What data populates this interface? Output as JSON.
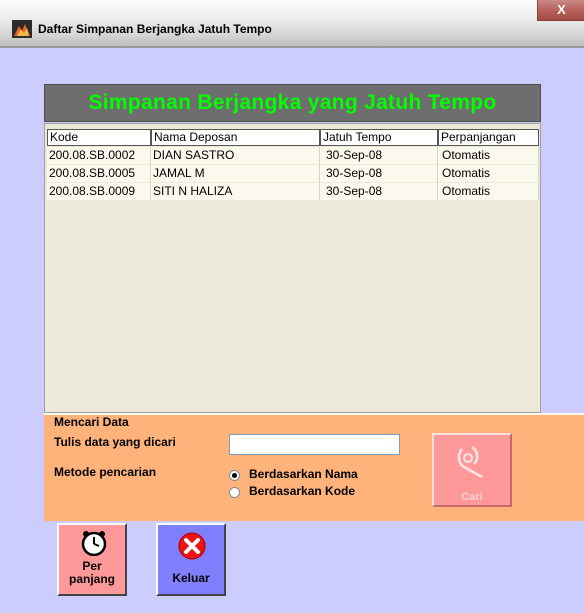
{
  "window": {
    "title": "Daftar Simpanan Berjangka Jatuh Tempo",
    "close_label": "X",
    "background_color": "#CCCCFF"
  },
  "heading": {
    "text": "Simpanan Berjangka yang Jatuh Tempo",
    "text_color": "#00FF00",
    "bar_color": "#6E6E6E"
  },
  "grid": {
    "columns": [
      "Kode",
      "Nama Deposan",
      "Jatuh Tempo",
      "Perpanjangan"
    ],
    "rows": [
      [
        "200.08.SB.0002",
        "DIAN SASTRO",
        "30-Sep-08",
        "Otomatis"
      ],
      [
        "200.08.SB.0005",
        "JAMAL M",
        "30-Sep-08",
        "Otomatis"
      ],
      [
        "200.08.SB.0009",
        "SITI N HALIZA",
        "30-Sep-08",
        "Otomatis"
      ]
    ]
  },
  "search": {
    "group_title": "Mencari Data",
    "input_label": "Tulis data yang dicari",
    "input_value": "",
    "method_label": "Metode pencarian",
    "options": [
      {
        "label": "Berdasarkan Nama",
        "checked": true
      },
      {
        "label": "Berdasarkan Kode",
        "checked": false
      }
    ],
    "cari_label": "Cari",
    "cari_icon": "search-tool-icon",
    "group_color": "#FFB27A"
  },
  "buttons": {
    "perpanjang": {
      "line1": "Per",
      "line2": "panjang",
      "icon": "clock-icon",
      "color": "#FF9999"
    },
    "keluar": {
      "label": "Keluar",
      "icon": "close-x-icon",
      "color": "#8080FF"
    }
  }
}
